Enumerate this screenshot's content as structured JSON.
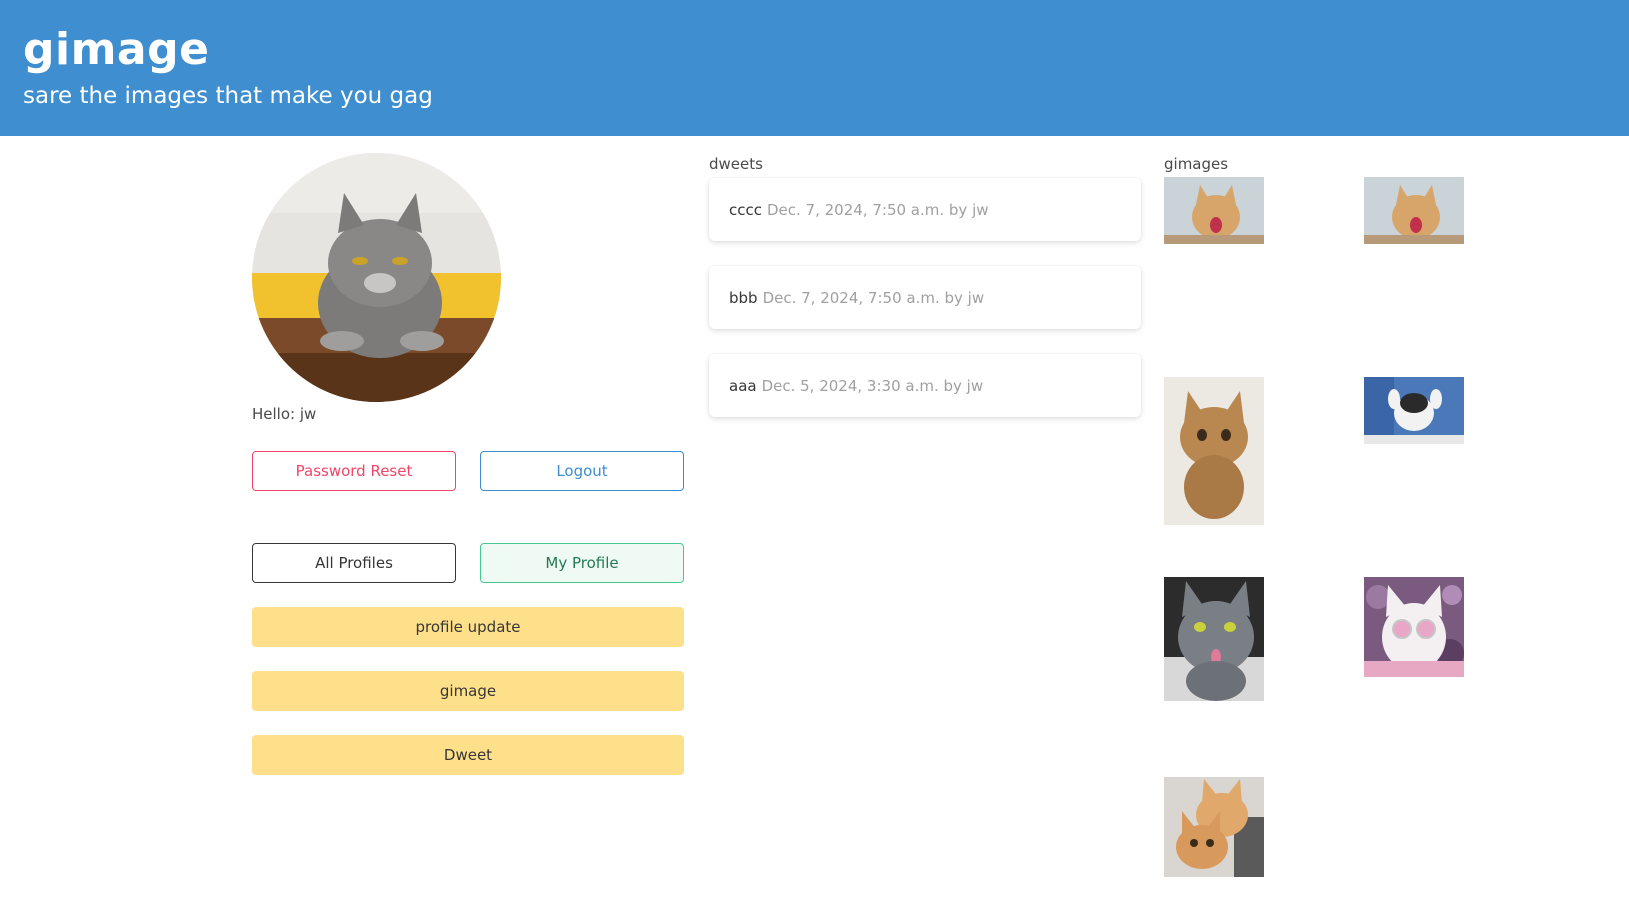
{
  "header": {
    "title": "gimage",
    "subtitle": "sare the images that make you gag"
  },
  "profile": {
    "greeting": "Hello: jw",
    "buttons": {
      "password_reset": "Password Reset",
      "logout": "Logout",
      "all_profiles": "All Profiles",
      "my_profile": "My Profile",
      "profile_update": "profile update",
      "gimage": "gimage",
      "dweet": "Dweet"
    }
  },
  "dweets": {
    "label": "dweets",
    "items": [
      {
        "body": "cccc",
        "meta": "Dec. 7, 2024, 7:50 a.m. by jw"
      },
      {
        "body": "bbb",
        "meta": "Dec. 7, 2024, 7:50 a.m. by jw"
      },
      {
        "body": "aaa",
        "meta": "Dec. 5, 2024, 3:30 a.m. by jw"
      }
    ]
  },
  "gimages": {
    "label": "gimages"
  },
  "colors": {
    "primary": "#3e8ed0",
    "danger": "#f14668",
    "success": "#48c78e",
    "warning": "#ffe08a"
  }
}
